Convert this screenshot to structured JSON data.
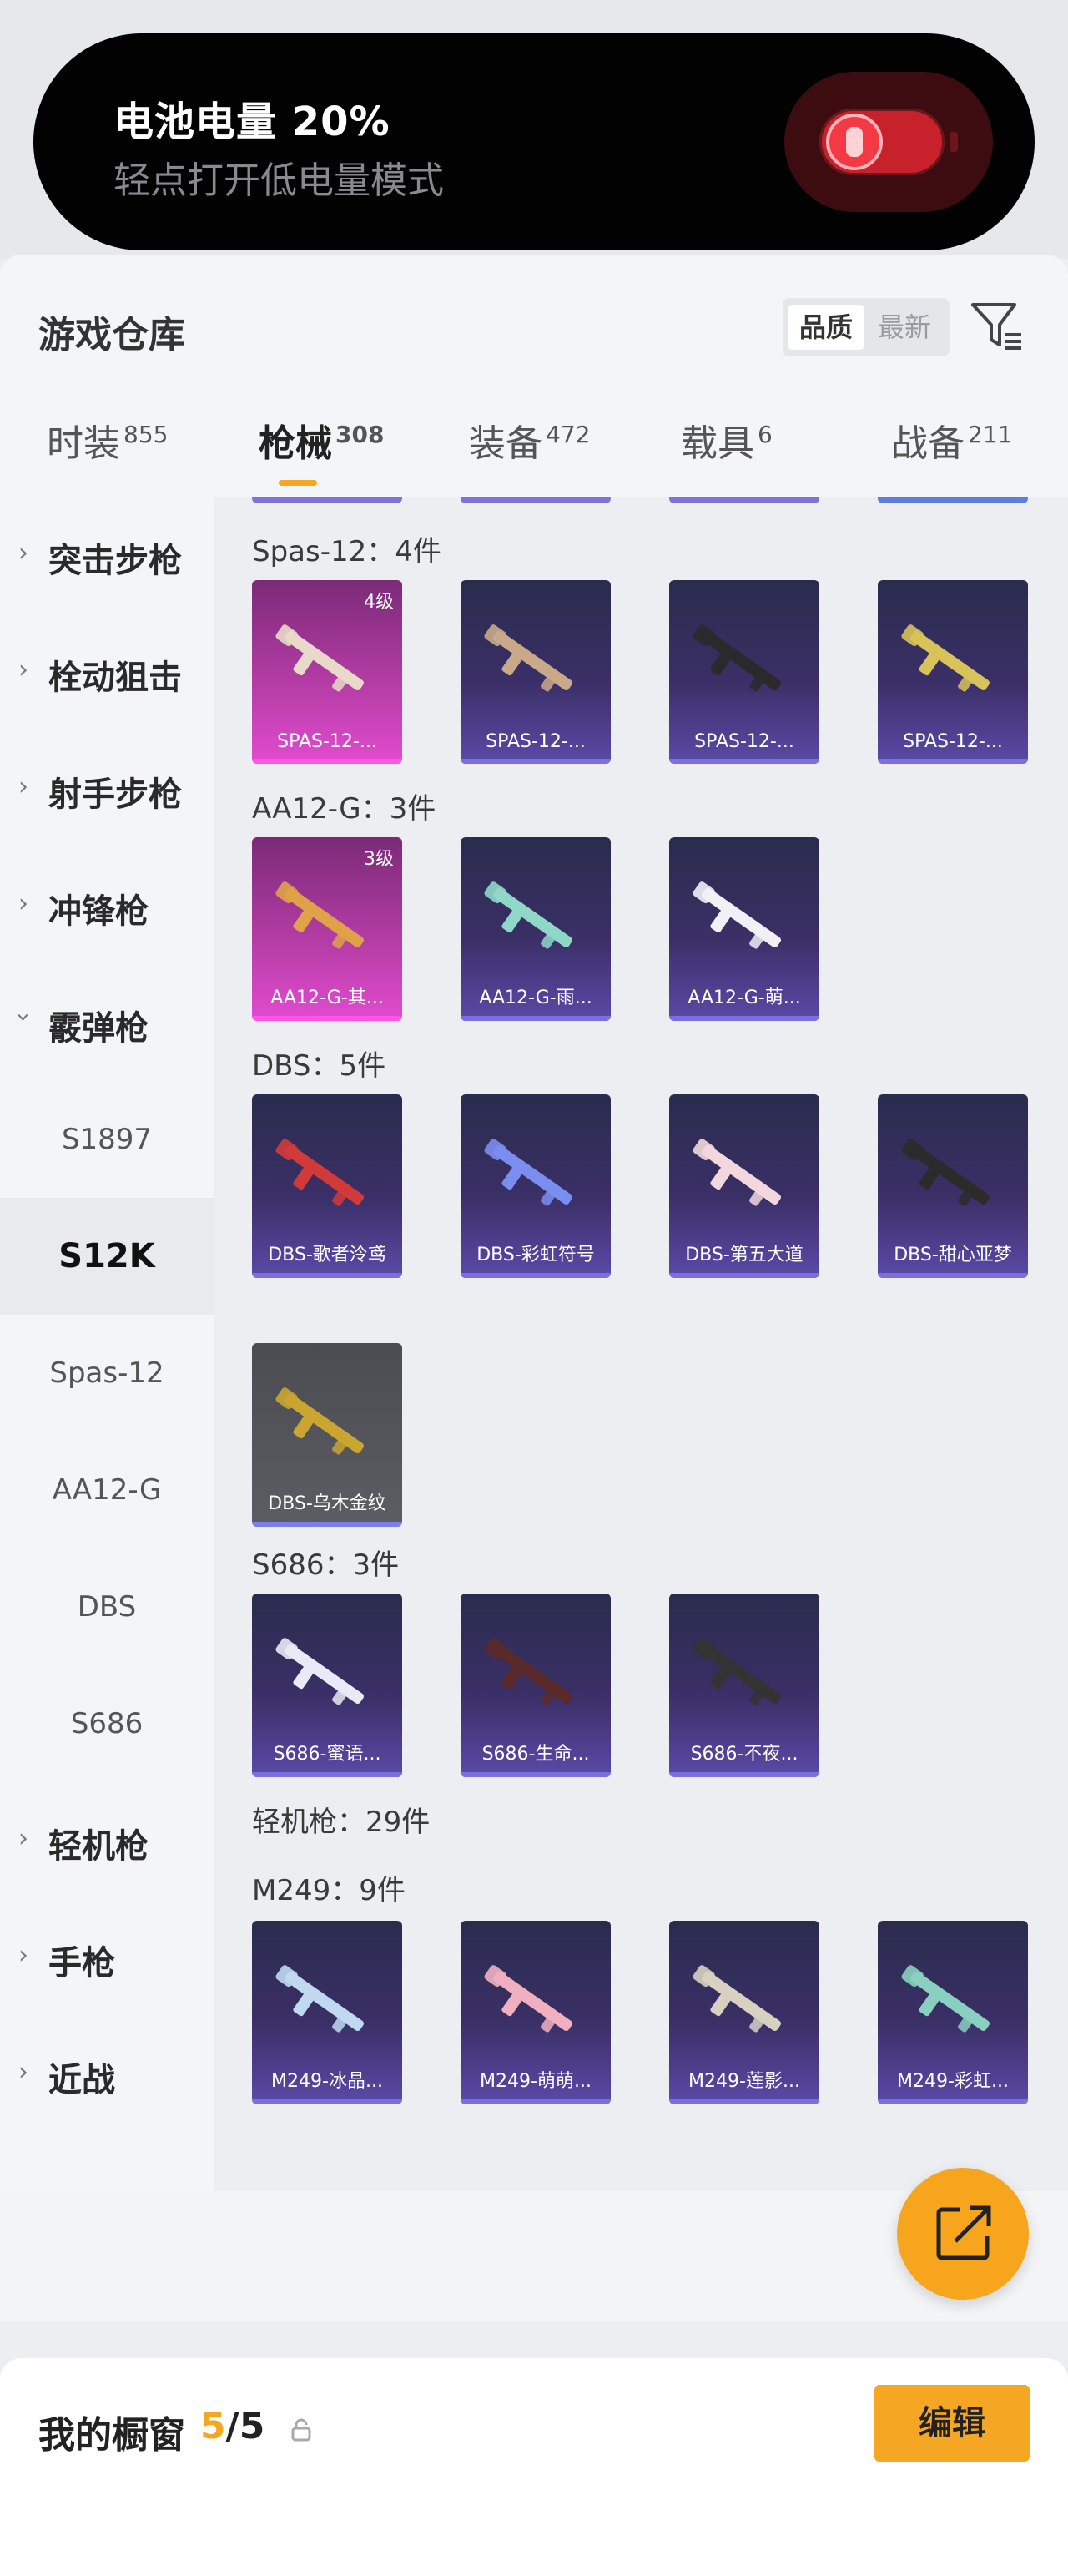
{
  "battery": {
    "title": "电池电量 20%",
    "subtitle": "轻点打开低电量模式"
  },
  "header": {
    "title": "游戏仓库",
    "sort_options": [
      "品质",
      "最新"
    ],
    "sort_selected": "品质"
  },
  "tabs": [
    {
      "label": "时装",
      "count": "855"
    },
    {
      "label": "枪械",
      "count": "308",
      "active": true
    },
    {
      "label": "装备",
      "count": "472"
    },
    {
      "label": "载具",
      "count": "6"
    },
    {
      "label": "战备",
      "count": "211"
    }
  ],
  "sidebar": {
    "categories": [
      {
        "label": "突击步枪",
        "expanded": false
      },
      {
        "label": "栓动狙击",
        "expanded": false
      },
      {
        "label": "射手步枪",
        "expanded": false
      },
      {
        "label": "冲锋枪",
        "expanded": false
      },
      {
        "label": "霰弹枪",
        "expanded": true
      },
      {
        "label": "轻机枪",
        "expanded": false
      },
      {
        "label": "手枪",
        "expanded": false
      },
      {
        "label": "近战",
        "expanded": false
      }
    ],
    "subitems": [
      {
        "label": "S1897"
      },
      {
        "label": "S12K",
        "active": true
      },
      {
        "label": "Spas-12"
      },
      {
        "label": "AA12-G"
      },
      {
        "label": "DBS"
      },
      {
        "label": "S686"
      }
    ]
  },
  "sections": [
    {
      "title": "Spas-12：4件",
      "items": [
        {
          "name": "SPAS-12-...",
          "level": "4级",
          "rarity": "pink"
        },
        {
          "name": "SPAS-12-...",
          "rarity": "purple"
        },
        {
          "name": "SPAS-12-...",
          "rarity": "purple"
        },
        {
          "name": "SPAS-12-...",
          "rarity": "purple"
        }
      ]
    },
    {
      "title": "AA12-G：3件",
      "items": [
        {
          "name": "AA12-G-其...",
          "level": "3级",
          "rarity": "pink"
        },
        {
          "name": "AA12-G-雨...",
          "rarity": "purple"
        },
        {
          "name": "AA12-G-萌...",
          "rarity": "purple"
        }
      ]
    },
    {
      "title": "DBS：5件",
      "items": [
        {
          "name": "DBS-歌者泠鸢",
          "rarity": "purple"
        },
        {
          "name": "DBS-彩虹符号",
          "rarity": "purple"
        },
        {
          "name": "DBS-第五大道",
          "rarity": "purple"
        },
        {
          "name": "DBS-甜心亚梦",
          "rarity": "purple"
        },
        {
          "name": "DBS-乌木金纹",
          "rarity": "gray"
        }
      ]
    },
    {
      "title": "S686：3件",
      "items": [
        {
          "name": "S686-蜜语...",
          "rarity": "purple"
        },
        {
          "name": "S686-生命...",
          "rarity": "purple"
        },
        {
          "name": "S686-不夜...",
          "rarity": "purple"
        }
      ]
    },
    {
      "title": "轻机枪：29件",
      "items": []
    },
    {
      "title": "M249：9件",
      "items": [
        {
          "name": "M249-冰晶...",
          "rarity": "purple"
        },
        {
          "name": "M249-萌萌...",
          "rarity": "purple"
        },
        {
          "name": "M249-莲影...",
          "rarity": "purple"
        },
        {
          "name": "M249-彩虹...",
          "rarity": "purple"
        }
      ]
    }
  ],
  "bottom": {
    "showcase_label": "我的橱窗",
    "showcase_current": "5",
    "showcase_total": "/5",
    "edit_label": "编辑"
  },
  "colors": {
    "accent": "#f5a623",
    "pink_rarity": "#e24bd0",
    "purple_rarity": "#5a4aa8"
  }
}
